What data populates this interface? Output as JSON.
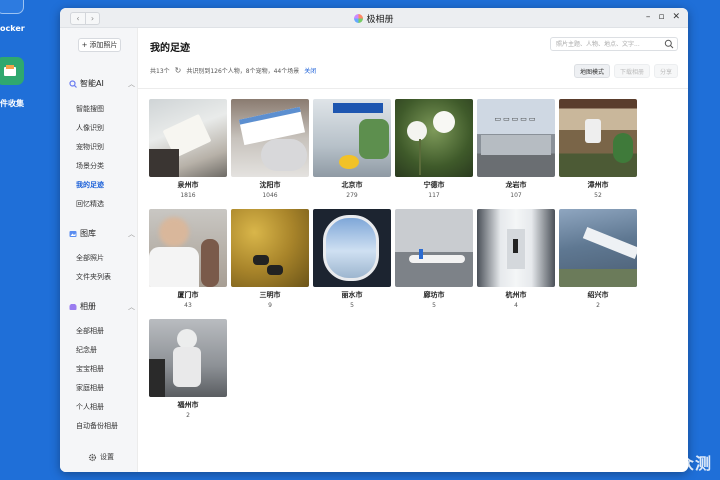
{
  "desktop": {
    "icon1_label": "ocker",
    "icon2_label": "件收集"
  },
  "window": {
    "title": "极相册",
    "back_icon": "chevron-left-icon",
    "forward_icon": "chevron-right-icon"
  },
  "sidebar": {
    "add_label": "添加照片",
    "sections": [
      {
        "title": "智能AI",
        "icon": "sparkle-search-icon",
        "items": [
          "智能搜图",
          "人像识别",
          "宠物识别",
          "场景分类",
          "我的足迹",
          "回忆精选"
        ]
      },
      {
        "title": "图库",
        "icon": "gallery-icon",
        "items": [
          "全部照片",
          "文件夹列表"
        ]
      },
      {
        "title": "相册",
        "icon": "album-icon",
        "items": [
          "全部相册",
          "纪念册",
          "宝宝相册",
          "家庭相册",
          "个人相册",
          "自动备份相册"
        ]
      }
    ],
    "active_item": "我的足迹",
    "settings_label": "设置"
  },
  "main": {
    "title": "我的足迹",
    "search_placeholder": "照片主题、人物、地点、文字...",
    "stats_total": "共13个",
    "stats_summary": "共识别到126个人物，8个宠物，44个场景",
    "stats_close": "关闭",
    "buttons": {
      "map": "地图模式",
      "download": "下载相册",
      "share": "分享"
    },
    "locations": [
      {
        "city": "泉州市",
        "count": "1816"
      },
      {
        "city": "沈阳市",
        "count": "1046"
      },
      {
        "city": "北京市",
        "count": "279"
      },
      {
        "city": "宁德市",
        "count": "117"
      },
      {
        "city": "龙岩市",
        "count": "107"
      },
      {
        "city": "漳州市",
        "count": "52"
      },
      {
        "city": "厦门市",
        "count": "43"
      },
      {
        "city": "三明市",
        "count": "9"
      },
      {
        "city": "丽水市",
        "count": "5"
      },
      {
        "city": "廊坊市",
        "count": "5"
      },
      {
        "city": "杭州市",
        "count": "4"
      },
      {
        "city": "绍兴市",
        "count": "2"
      },
      {
        "city": "福州市",
        "count": "2"
      }
    ]
  },
  "watermark": "新浪众测",
  "colors": {
    "accent": "#1a5fd8",
    "desktop_bg": "#1f6fd8"
  }
}
